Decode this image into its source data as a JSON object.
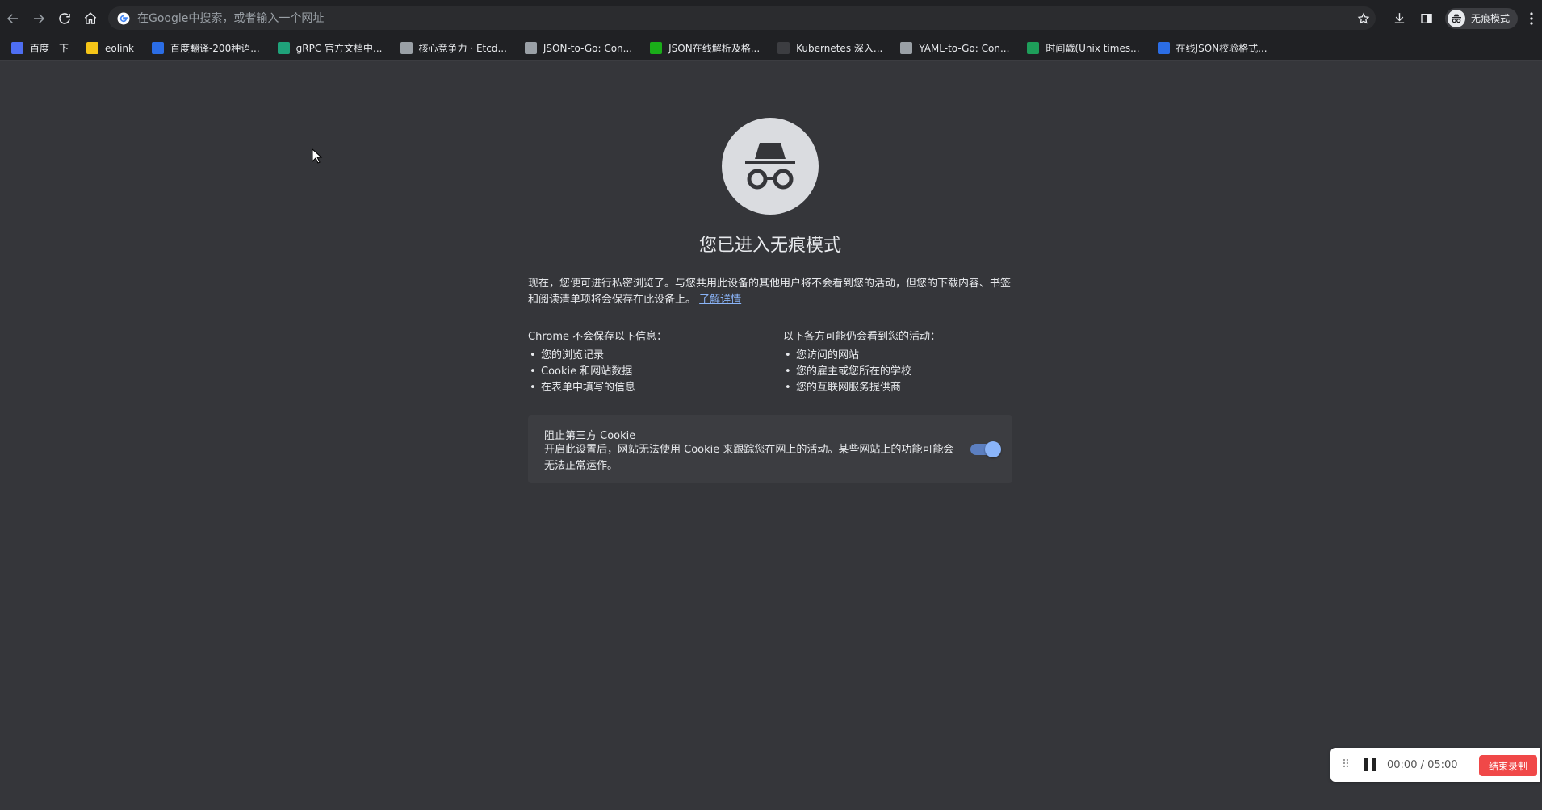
{
  "toolbar": {
    "omnibox_placeholder": "在Google中搜索，或者输入一个网址",
    "incognito_label": "无痕模式"
  },
  "bookmarks": [
    {
      "label": "百度一下",
      "color": "#4e6ef2"
    },
    {
      "label": "eolink",
      "color": "#f5c518"
    },
    {
      "label": "百度翻译-200种语...",
      "color": "#2b6de5"
    },
    {
      "label": "gRPC 官方文档中...",
      "color": "#1fa27a"
    },
    {
      "label": "核心竞争力 · Etcd...",
      "color": "#9aa0a6"
    },
    {
      "label": "JSON-to-Go: Con...",
      "color": "#9aa0a6"
    },
    {
      "label": "JSON在线解析及格...",
      "color": "#1aad19"
    },
    {
      "label": "Kubernetes 深入...",
      "color": "#3c3d41"
    },
    {
      "label": "YAML-to-Go: Con...",
      "color": "#9aa0a6"
    },
    {
      "label": "时间戳(Unix times...",
      "color": "#1e9e5a"
    },
    {
      "label": "在线JSON校验格式...",
      "color": "#2b6de5"
    }
  ],
  "page": {
    "heading": "您已进入无痕模式",
    "intro": "现在，您便可进行私密浏览了。与您共用此设备的其他用户将不会看到您的活动，但您的下载内容、书签和阅读清单项将会保存在此设备上。",
    "learn_more": "了解详情",
    "left_title": "Chrome 不会保存以下信息：",
    "left_items": [
      "您的浏览记录",
      "Cookie 和网站数据",
      "在表单中填写的信息"
    ],
    "right_title": "以下各方可能仍会看到您的活动：",
    "right_items": [
      "您访问的网站",
      "您的雇主或您所在的学校",
      "您的互联网服务提供商"
    ],
    "cookie_title": "阻止第三方 Cookie",
    "cookie_desc": "开启此设置后，网站无法使用 Cookie 来跟踪您在网上的活动。某些网站上的功能可能会无法正常运作。",
    "cookie_toggle_on": true
  },
  "recorder": {
    "time": "00:00 / 05:00",
    "stop_label": "结束录制"
  }
}
